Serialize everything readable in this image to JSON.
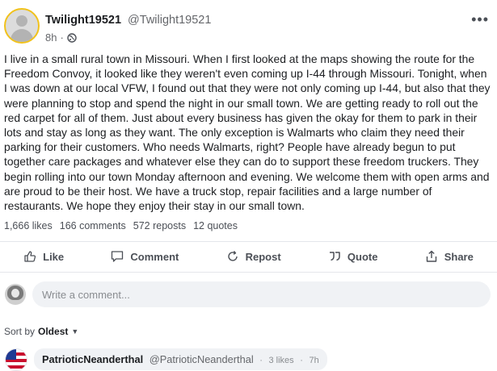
{
  "post": {
    "author_name": "Twilight19521",
    "author_handle": "@Twilight19521",
    "time": "8h",
    "dot": "·",
    "visibility_icon": "globe-icon",
    "text": "I live in a small rural town in Missouri. When I first looked at the maps showing the route for the Freedom Convoy, it looked like they weren't even coming up I-44 through Missouri. Tonight, when I was down at our local VFW, I found out that they were not only coming up I-44, but also that they were planning to stop and spend the night in our small town. We are getting ready to roll out the red carpet for all of them. Just about every business has given the okay for them to park in their lots and stay as long as they want. The only exception is Walmarts who claim they need their parking for their customers. Who needs Walmarts, right? People have already begun to put together care packages and whatever else they can do to support these freedom truckers. They begin rolling into our town Monday afternoon and evening. We welcome them with open arms and are proud to be their host. We have a truck stop, repair facilities and a large number of restaurants. We hope they enjoy their stay in our small town."
  },
  "stats": {
    "likes": "1,666 likes",
    "comments": "166 comments",
    "reposts": "572 reposts",
    "quotes": "12 quotes"
  },
  "actions": {
    "like": "Like",
    "comment": "Comment",
    "repost": "Repost",
    "quote": "Quote",
    "share": "Share"
  },
  "comment_box": {
    "placeholder": "Write a comment..."
  },
  "sort": {
    "label": "Sort by",
    "value": "Oldest"
  },
  "first_comment": {
    "name": "PatrioticNeanderthal",
    "handle": "@PatrioticNeanderthal",
    "likes": "3 likes",
    "dot": "·",
    "time": "7h"
  },
  "colors": {
    "avatar_ring": "#f1c21b",
    "bubble_bg": "#f0f2f5",
    "muted_text": "#65676b"
  }
}
